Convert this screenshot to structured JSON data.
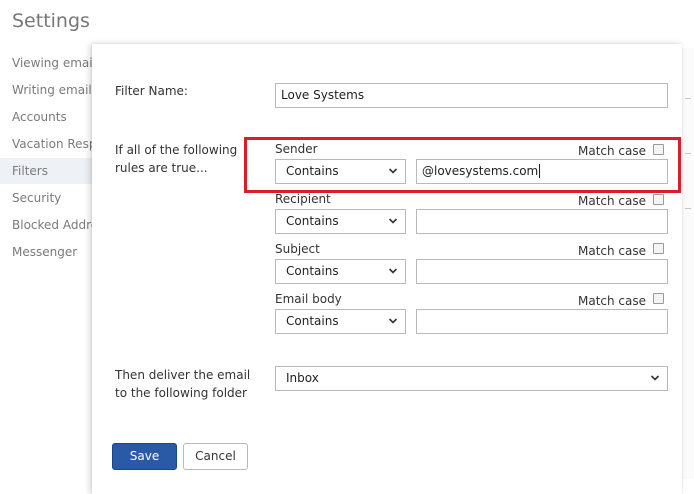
{
  "page": {
    "title": "Settings"
  },
  "sidebar": {
    "items": [
      {
        "label": "Viewing email"
      },
      {
        "label": "Writing email"
      },
      {
        "label": "Accounts"
      },
      {
        "label": "Vacation Resp"
      },
      {
        "label": "Filters",
        "active": true
      },
      {
        "label": "Security"
      },
      {
        "label": "Blocked Addre"
      },
      {
        "label": "Messenger"
      }
    ]
  },
  "filter": {
    "name_label": "Filter Name:",
    "name_value": "Love Systems",
    "rules_label": "If all of the following rules are true...",
    "rules": [
      {
        "name": "Sender",
        "operator": "Contains",
        "value": "@lovesystems.com",
        "match_case_label": "Match case",
        "match_case": false
      },
      {
        "name": "Recipient",
        "operator": "Contains",
        "value": "",
        "match_case_label": "Match case",
        "match_case": false
      },
      {
        "name": "Subject",
        "operator": "Contains",
        "value": "",
        "match_case_label": "Match case",
        "match_case": false
      },
      {
        "name": "Email body",
        "operator": "Contains",
        "value": "",
        "match_case_label": "Match case",
        "match_case": false
      }
    ],
    "deliver_label": "Then deliver the email to the following folder",
    "deliver_folder": "Inbox"
  },
  "buttons": {
    "save": "Save",
    "cancel": "Cancel"
  },
  "colors": {
    "highlight": "#d81e28",
    "primary_button": "#2a5aa6"
  }
}
